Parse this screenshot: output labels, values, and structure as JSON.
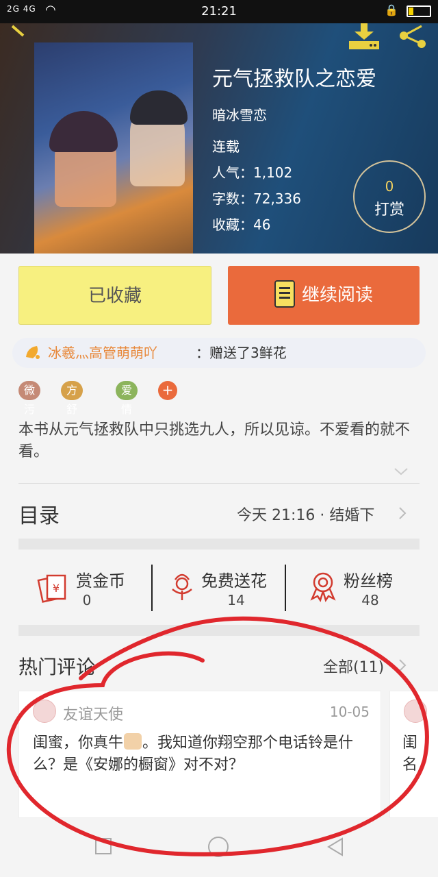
{
  "status_bar": {
    "signal": "2G 4G",
    "time": "21:21"
  },
  "book": {
    "title": "元气拯救队之恋爱",
    "author": "暗冰雪恋",
    "status": "连载",
    "popularity": "人气：1,102",
    "word_count": "字数：72,336",
    "favorites": "收藏：46",
    "tip_count": "0",
    "tip_label": "打赏"
  },
  "actions": {
    "favorited_label": "已收藏",
    "continue_label": "继续阅读"
  },
  "gift": {
    "donor": "冰羲灬高管萌萌吖",
    "action": "：赠送了3鲜花"
  },
  "tags": [
    {
      "label": "微污",
      "color": "#c58a76"
    },
    {
      "label": "方舒文",
      "color": "#d6a14a"
    },
    {
      "label": "爱情",
      "color": "#8cb45c"
    }
  ],
  "tag_add": "+",
  "description": "本书从元气拯救队中只挑选九人，所以见谅。不爱看的就不看。",
  "toc": {
    "title": "目录",
    "latest": "今天 21:16 · 结婚下"
  },
  "stats": [
    {
      "label": "赏金币",
      "value": "0"
    },
    {
      "label": "免费送花",
      "value": "14"
    },
    {
      "label": "粉丝榜",
      "value": "48"
    }
  ],
  "hot_comments": {
    "title": "热门评论",
    "all": "全部(11)",
    "comments": [
      {
        "user": "友谊天使",
        "date": "10-05",
        "text_a": "闺蜜，你真牛",
        "text_b": "。我知道你翔空那个电话铃是什么？是《安娜的橱窗》对不对？"
      },
      {
        "text_fragment": "闺名"
      }
    ]
  },
  "colors": {
    "accent_orange": "#ea6a3c",
    "favorited_yellow": "#f7f080",
    "annotation_red": "#e0272d"
  }
}
